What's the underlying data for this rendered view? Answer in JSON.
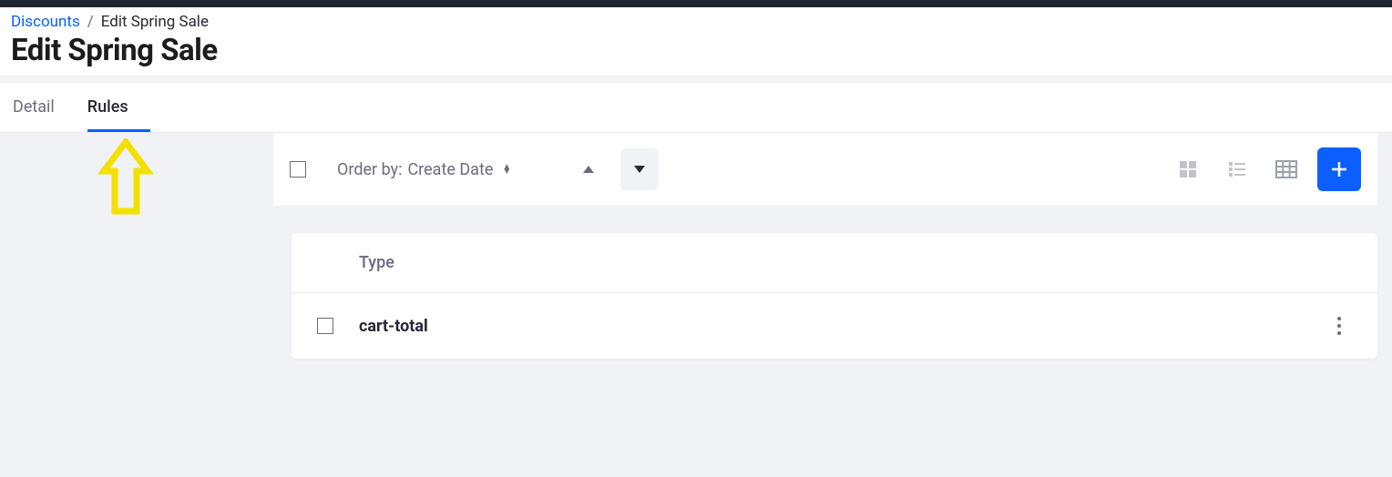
{
  "breadcrumb": {
    "parent": "Discounts",
    "current": "Edit Spring Sale"
  },
  "page_title": "Edit Spring Sale",
  "tabs": {
    "detail": "Detail",
    "rules": "Rules"
  },
  "toolbar": {
    "order_by_prefix": "Order by:",
    "order_by_field": "Create Date"
  },
  "table": {
    "columns": {
      "type": "Type"
    },
    "rows": [
      {
        "type": "cart-total"
      }
    ]
  }
}
